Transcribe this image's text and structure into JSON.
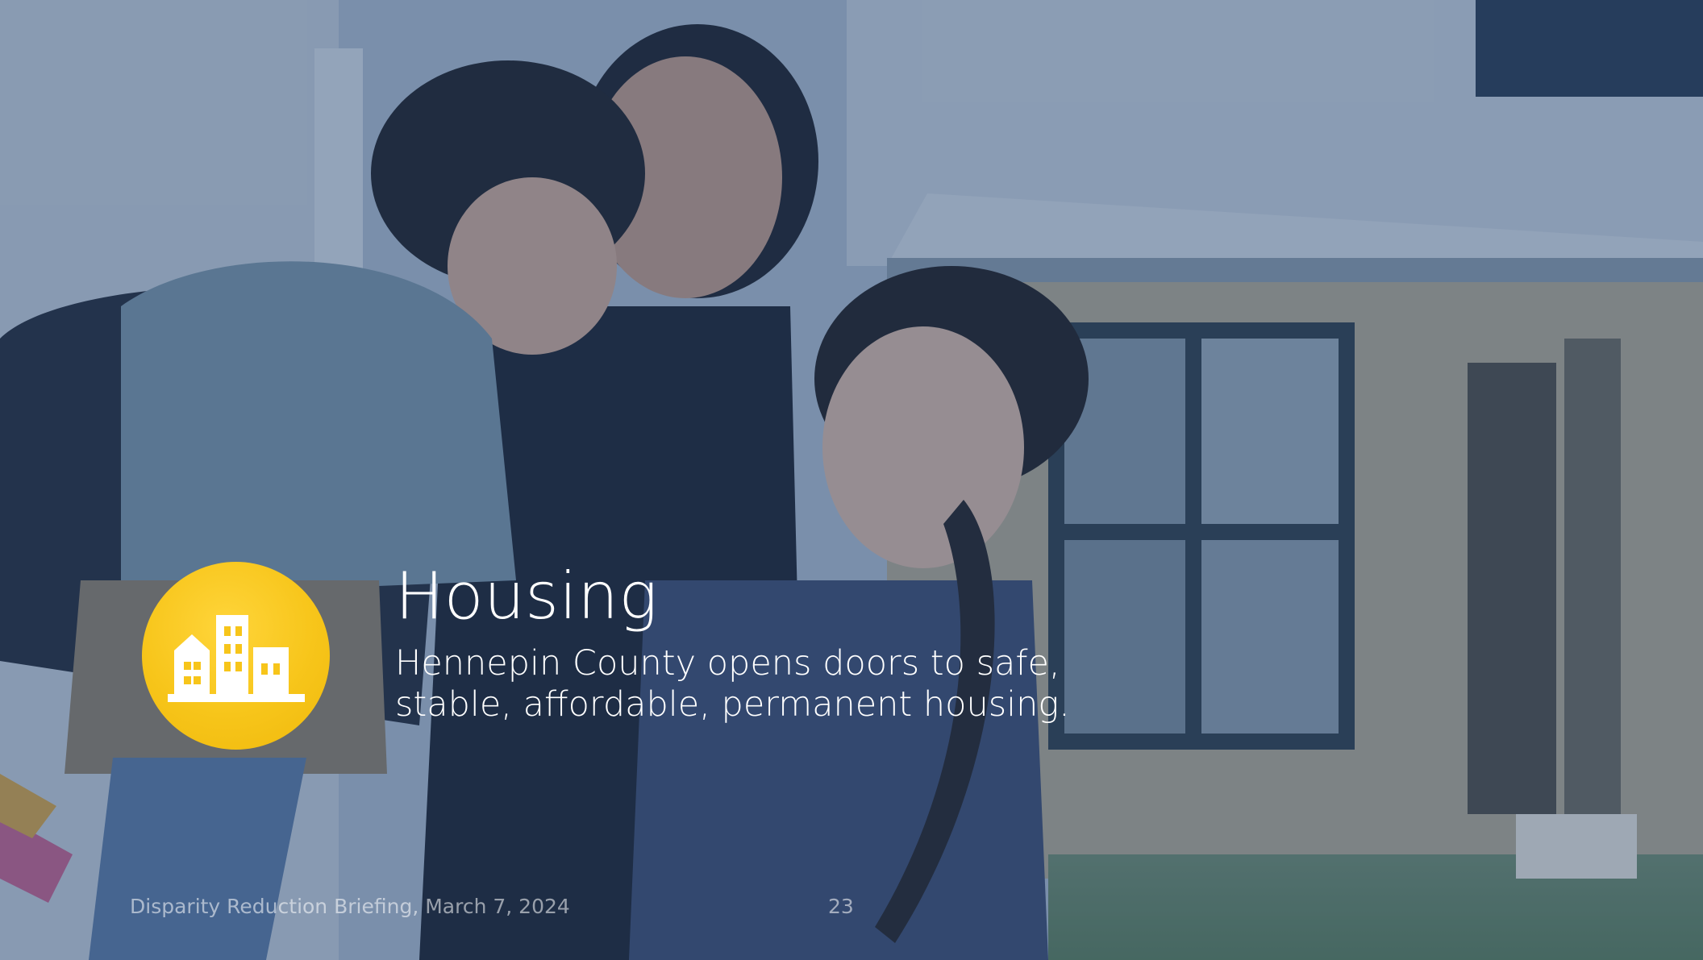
{
  "slide": {
    "title": "Housing",
    "subtitle": "Hennepin County opens doors to safe, stable, affordable, permanent housing.",
    "footer": "Disparity Reduction Briefing, March 7, 2024",
    "page_number": "23",
    "icon": "buildings-icon",
    "colors": {
      "overlay": "#264876",
      "icon_circle": "#f7c51a",
      "text": "#ffffff"
    }
  }
}
